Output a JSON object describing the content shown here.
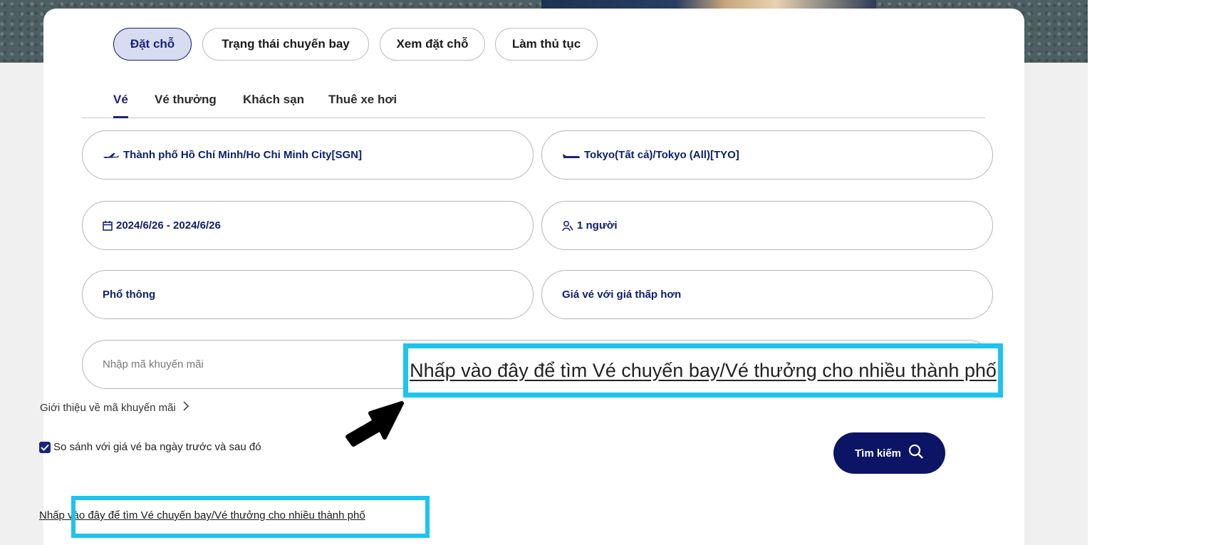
{
  "top_tabs": [
    {
      "label": "Đặt chỗ"
    },
    {
      "label": "Trạng thái chuyến bay"
    },
    {
      "label": "Xem đặt chỗ"
    },
    {
      "label": "Làm thủ tục"
    }
  ],
  "sub_tabs": [
    {
      "label": "Vé"
    },
    {
      "label": "Vé thưởng"
    },
    {
      "label": "Khách sạn"
    },
    {
      "label": "Thuê xe hơi"
    }
  ],
  "form": {
    "origin": "Thành phố Hồ Chí Minh/Ho Chi Minh City[SGN]",
    "destination": "Tokyo(Tất cả)/Tokyo (All)[TYO]",
    "dates": "2024/6/26 - 2024/6/26",
    "passengers": "1 người",
    "cabin_class": "Phổ thông",
    "fare_option": "Giá vé với giá thấp hơn",
    "promo_placeholder": "Nhập mã khuyến mãi"
  },
  "promo_info_link": "Giới thiệu về mã khuyến mãi",
  "compare_checkbox": {
    "label": "So sánh với giá vé ba ngày trước và sau đó",
    "checked": true
  },
  "search_button": "Tìm kiếm",
  "multi_city_link": "Nhấp vào đây để tìm Vé chuyến bay/Vé thưởng cho nhiều thành phố",
  "callout_text": "Nhấp vào đây để tìm Vé chuyến bay/Vé thưởng cho nhiều thành phố",
  "colors": {
    "brand": "#1a237e",
    "highlight": "#1ec3ee",
    "button": "#0c1466"
  },
  "icons": [
    "plane-takeoff-icon",
    "plane-landing-icon",
    "calendar-icon",
    "passenger-icon",
    "chevron-right-icon",
    "checkmark-icon",
    "search-icon"
  ]
}
